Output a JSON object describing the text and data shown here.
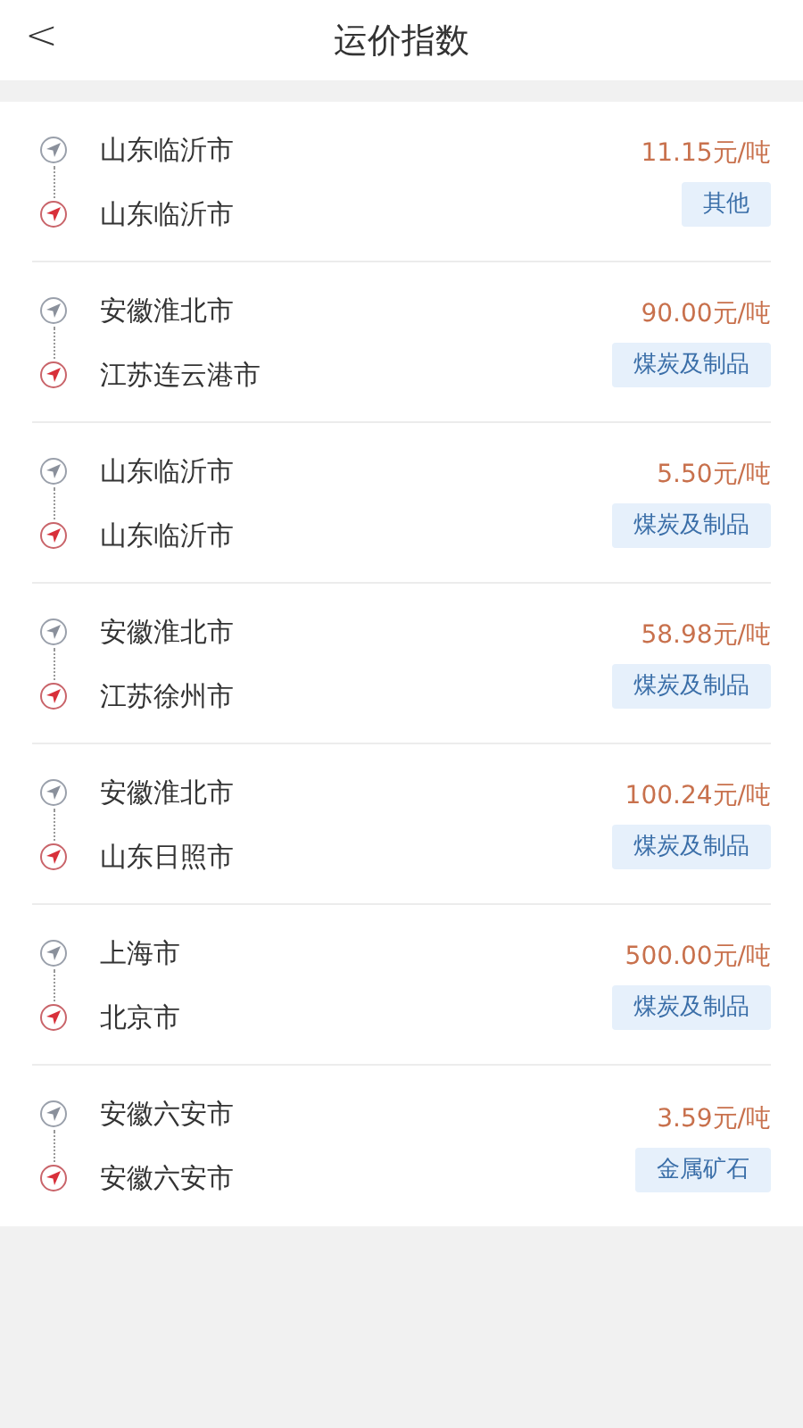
{
  "header": {
    "back": "<",
    "title": "运价指数"
  },
  "routes": [
    {
      "origin": "山东临沂市",
      "destination": "山东临沂市",
      "price": "11.15元/吨",
      "category": "其他"
    },
    {
      "origin": "安徽淮北市",
      "destination": "江苏连云港市",
      "price": "90.00元/吨",
      "category": "煤炭及制品"
    },
    {
      "origin": "山东临沂市",
      "destination": "山东临沂市",
      "price": "5.50元/吨",
      "category": "煤炭及制品"
    },
    {
      "origin": "安徽淮北市",
      "destination": "江苏徐州市",
      "price": "58.98元/吨",
      "category": "煤炭及制品"
    },
    {
      "origin": "安徽淮北市",
      "destination": "山东日照市",
      "price": "100.24元/吨",
      "category": "煤炭及制品"
    },
    {
      "origin": "上海市",
      "destination": "北京市",
      "price": "500.00元/吨",
      "category": "煤炭及制品"
    },
    {
      "origin": "安徽六安市",
      "destination": "安徽六安市",
      "price": "3.59元/吨",
      "category": "金属矿石"
    }
  ]
}
